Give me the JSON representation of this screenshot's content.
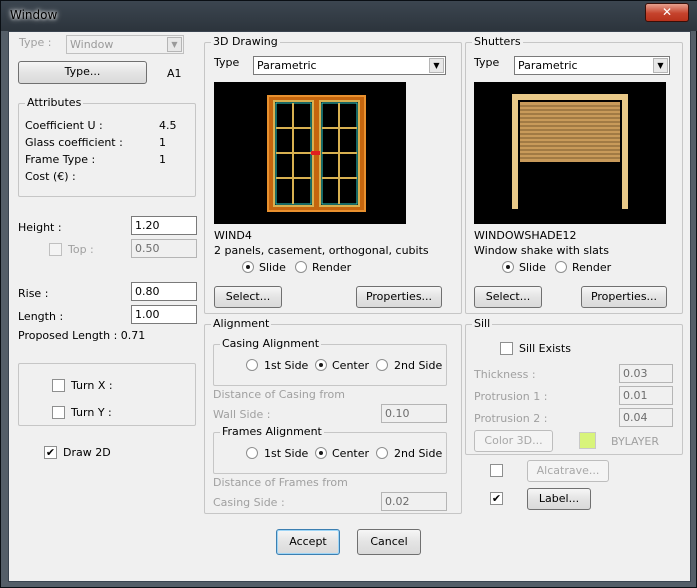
{
  "window": {
    "title": "Window",
    "close": "✕"
  },
  "left": {
    "type_label": "Type :",
    "type_value": "Window",
    "type_button": "Type...",
    "type_code": "A1",
    "attributes": {
      "title": "Attributes",
      "rows": [
        {
          "label": "Coefficient U :",
          "value": "4.5"
        },
        {
          "label": "Glass coefficient :",
          "value": "1"
        },
        {
          "label": "Frame Type :",
          "value": "1"
        },
        {
          "label": "Cost (€) :",
          "value": ""
        }
      ]
    },
    "height_label": "Height :",
    "height_value": "1.20",
    "top_label": "Top :",
    "top_value": "0.50",
    "rise_label": "Rise :",
    "rise_value": "0.80",
    "length_label": "Length :",
    "length_value": "1.00",
    "proposed_length": "Proposed Length : 0.71",
    "turn_x": "Turn X :",
    "turn_y": "Turn Y :",
    "draw2d": "Draw 2D"
  },
  "drawing3d": {
    "title": "3D Drawing",
    "type_label": "Type",
    "type_value": "Parametric",
    "model_name": "WIND4",
    "description": "2 panels, casement, orthogonal, cubits",
    "slide": "Slide",
    "render": "Render",
    "select_button": "Select...",
    "properties_button": "Properties..."
  },
  "shutters": {
    "title": "Shutters",
    "type_label": "Type",
    "type_value": "Parametric",
    "model_name": "WINDOWSHADE12",
    "description": "Window shake with slats",
    "slide": "Slide",
    "render": "Render",
    "select_button": "Select...",
    "properties_button": "Properties..."
  },
  "alignment": {
    "title": "Alignment",
    "casing_title": "Casing Alignment",
    "frames_title": "Frames Alignment",
    "first_side": "1st Side",
    "center": "Center",
    "second_side": "2nd Side",
    "casing_distance_label1": "Distance of Casing from",
    "casing_distance_label2": "Wall Side :",
    "casing_distance_value": "0.10",
    "frames_distance_label1": "Distance of Frames from",
    "frames_distance_label2": "Casing Side :",
    "frames_distance_value": "0.02"
  },
  "sill": {
    "title": "Sill",
    "exists_label": "Sill Exists",
    "thickness_label": "Thickness :",
    "thickness_value": "0.03",
    "protrusion1_label": "Protrusion 1 :",
    "protrusion1_value": "0.01",
    "protrusion2_label": "Protrusion 2 :",
    "protrusion2_value": "0.04",
    "color_button": "Color 3D...",
    "color_swatch": "#d8f47a",
    "color_name": "BYLAYER"
  },
  "extras": {
    "alcatrave_button": "Alcatrave...",
    "label_button": "Label...",
    "check_mark": "✔"
  },
  "footer": {
    "accept": "Accept",
    "cancel": "Cancel"
  }
}
